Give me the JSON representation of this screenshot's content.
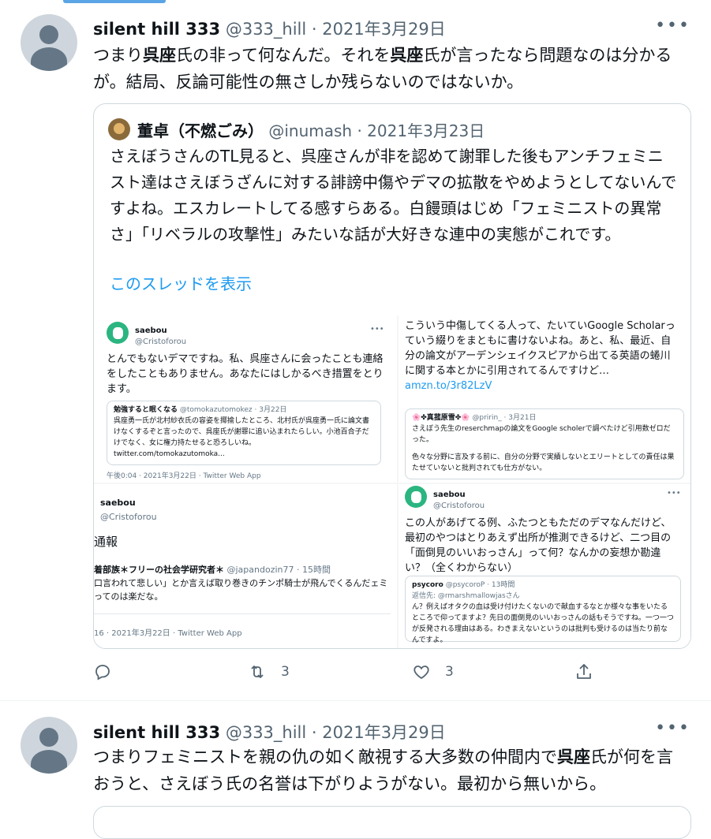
{
  "tweet1": {
    "name": "silent hill 333",
    "meta": "@333_hill · 2021年3月29日",
    "text_parts": [
      "つまり",
      "呉座",
      "氏の非って何なんだ。それを",
      "呉座",
      "氏が言ったなら問題なのは分かるが。結局、反論可能性の無さしか残らないのではないか。"
    ],
    "more": "•••",
    "quote": {
      "name": "董卓（不燃ごみ）",
      "meta": "@inumash · 2021年3月23日",
      "text": "さえぼうさんのTL見ると、呉座さんが非を認めて謝罪した後もアンチフェミニスト達はさえぼうざんに対する誹謗中傷やデマの拡散をやめようとしてないんですよね。エスカレートしてる感すらある。白饅頭はじめ「フェミニストの異常さ」「リベラルの攻撃性」みたいな話が大好きな連中の実態がこれです。",
      "show_thread": "このスレッドを表示",
      "shot1": {
        "name": "saebou",
        "handle": "@Cristoforou",
        "dots": "•••",
        "body": "とんでもないデマですね。私、呉座さんに会ったことも連絡をしたこともありません。あなたにはしかるべき措置をとります。",
        "q_name": "勉強すると眠くなる",
        "q_handle": "@tomokazutomokez · 3月22日",
        "q_text": "呉座勇一氏が北村紗衣氏の容姿を揶揄したところ、北村氏が呉座勇一氏に論文書けなくするぞと言ったので、呉座氏が謝罪に追い込まれたらしい。小池百合子だけでなく、女に権力持たせると恐ろしいね。",
        "q_link": "twitter.com/tomokazutomoka...",
        "foot": "午後0:04 · 2021年3月22日 · Twitter Web App"
      },
      "shot2": {
        "body": "こういう中傷してくる人って、たいていGoogle Scholarっていう綴りをまともに書けないよね。あと、私、最近、自分の論文がアーデンシェイクスピアから出てる英語の蜷川に関する本とかに引用されてるんですけど…",
        "link": "amzn.to/3r82LzV",
        "q_name": "🌸✤真菰原雪✤🌸",
        "q_handle": "@pririn_ · 3月21日",
        "q_text1": "さえぼう先生のreserchmapの論文をGoogle scholerで調べたけど引用数ゼロだった。",
        "q_text2": "色々な分野に言及する前に、自分の分野で実績しないとエリートとしての責任は果たせていないと批判されても仕方がない。"
      },
      "shot3": {
        "name": "saebou",
        "handle": "@Cristoforou",
        "report": "通報",
        "q_name": "着部族＊フリーの社会学研究者＊",
        "q_handle": "@japandozin77 · 15時間",
        "q_text": "口言われて悲しい」とか言えば取り巻きのチンポ騎士が飛んでくるんだェミってのは楽だな。",
        "foot": "16 · 2021年3月22日 · Twitter Web App"
      },
      "shot4": {
        "name": "saebou",
        "handle": "@Cristoforou",
        "dots": "•••",
        "body": "この人があげてる例、ふたつともただのデマなんだけど、最初のやつはとりあえず出所が推測できるけど、二つ目の「面倒見のいいおっさん」って何？なんかの妄想か勘違い？（全くわからない）",
        "q_name": "psycoro",
        "q_handle": "@psycoroP · 13時間",
        "q_reply": "返信先: @rmarshmallowjasさん",
        "q_text": "ん？例えばオタクの血は受け付けたくないので献血するなとか様々な事をいたるところで仰ってますよ？先日の面倒見のいいおっさんの話もそうですね。一つ一つが反発される理由はある。わきまえないというのは批判も受けるのは当たり前なんですよ。"
      }
    },
    "actions": {
      "retweets": "3",
      "likes": "3"
    }
  },
  "tweet2": {
    "name": "silent hill 333",
    "meta": "@333_hill · 2021年3月29日",
    "text_parts": [
      "つまりフェミニストを親の仇の如く敵視する大多数の仲間内で",
      "呉座",
      "氏が何を言おうと、さえぼう氏の名誉は下がりようがない。最初から無いから。"
    ],
    "more": "•••"
  }
}
